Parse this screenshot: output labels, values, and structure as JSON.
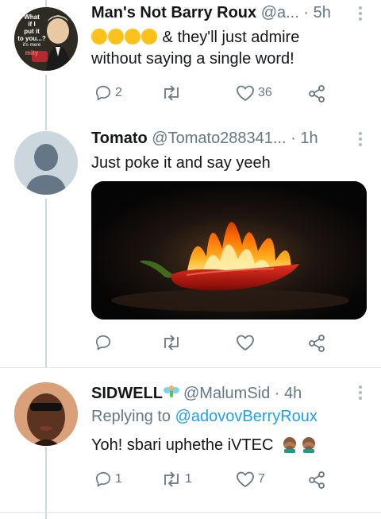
{
  "tweets": [
    {
      "name": "Man's Not Barry Roux",
      "handle": "@a...",
      "time": "· 5h",
      "emojis": [
        "rolling-on-floor-laughing",
        "rolling-on-floor-laughing",
        "tears-of-joy",
        "rolling-on-floor-laughing"
      ],
      "text_line1": " & they'll just admire",
      "text_line2": "without saying a single word!",
      "avatar_text": [
        "What",
        "if I",
        "put it",
        "to you...?",
        "it's mere",
        "mity"
      ],
      "replies": "2",
      "retweets": "",
      "likes": "36"
    },
    {
      "name": "Tomato",
      "handle": "@Tomato288341...",
      "time": "· 1h",
      "text": "Just poke it and say yeeh",
      "media": "flaming-chili-pepper-image",
      "replies": "",
      "retweets": "",
      "likes": ""
    },
    {
      "name": "SIDWELL",
      "name_emoji": "fairy",
      "handle": "@MalumSid",
      "time": "· 4h",
      "replying_prefix": "Replying to ",
      "replying_to": "@adovovBerryRoux",
      "text": "Yoh! sbari uphethe iVTEC ",
      "text_emojis": [
        "person-facepalming",
        "person-facepalming"
      ],
      "replies": "1",
      "retweets": "1",
      "likes": "7"
    }
  ],
  "colors": {
    "icon": "#657786",
    "link": "#1da1f2",
    "divider": "#e1e8ed",
    "thread": "#ccd6dd"
  }
}
